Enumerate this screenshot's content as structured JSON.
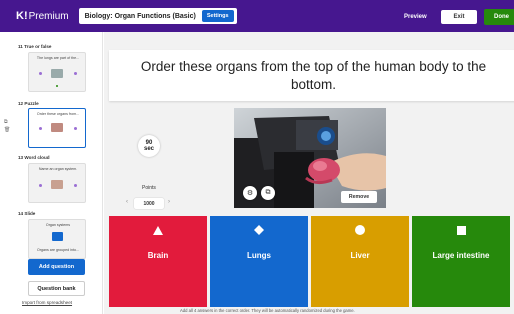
{
  "topbar": {
    "logo_k": "K!",
    "logo_text": "Premium",
    "kahoot_title": "Biology: Organ Functions (Basic)",
    "settings_label": "Settings",
    "preview_label": "Preview",
    "exit_label": "Exit",
    "done_label": "Done",
    "bg_color": "#46178f"
  },
  "sidebar": {
    "slides": [
      {
        "label": "11 True or false",
        "thumb_text": "The lungs are part of the..."
      },
      {
        "label": "12 Puzzle",
        "thumb_text": "Order these organs from..."
      },
      {
        "label": "13 Word cloud",
        "thumb_text": "Name an organ system."
      },
      {
        "label": "14 Slide",
        "thumb_text": "Organ systems",
        "thumb_text2": "Organs are grouped into..."
      }
    ],
    "add_question_label": "Add question",
    "question_bank_label": "Question bank",
    "import_label": "Import from spreadsheet"
  },
  "editor": {
    "question_text": "Order these organs from the top of the human body to the bottom.",
    "timer_value": "90",
    "timer_unit": "sec",
    "points_label": "Points",
    "points_value": "1000",
    "remove_label": "Remove",
    "hint_text": "Add all 4 answers in the correct order. They will be automatically randomized during the game."
  },
  "answers": [
    {
      "label": "Brain",
      "shape": "triangle",
      "color": "#e21b3c"
    },
    {
      "label": "Lungs",
      "shape": "diamond",
      "color": "#1368ce"
    },
    {
      "label": "Liver",
      "shape": "circle",
      "color": "#d89e00"
    },
    {
      "label": "Large intestine",
      "shape": "square",
      "color": "#26890c"
    }
  ]
}
